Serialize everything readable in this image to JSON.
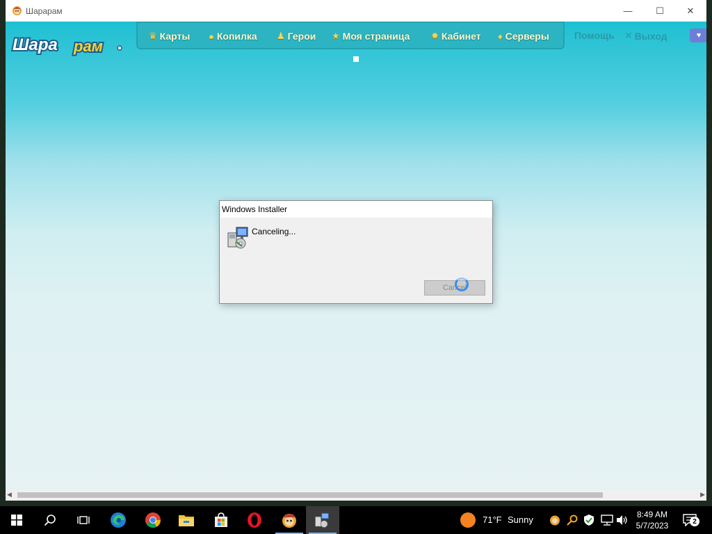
{
  "window": {
    "title": "Шарарам",
    "minimize_glyph": "—",
    "maximize_glyph": "☐",
    "close_glyph": "✕"
  },
  "site": {
    "logo_text": "Шарарам",
    "nav": [
      {
        "label": "Карты",
        "icon": "crown-icon",
        "glyph": "♛"
      },
      {
        "label": "Копилка",
        "icon": "piggy-bank-icon",
        "glyph": "●"
      },
      {
        "label": "Герои",
        "icon": "hero-icon",
        "glyph": "♟"
      },
      {
        "label": "Моя страница",
        "icon": "star-icon",
        "glyph": "★"
      },
      {
        "label": "Кабинет",
        "icon": "gear-icon",
        "glyph": "✹"
      },
      {
        "label": "Серверы",
        "icon": "map-pin-icon",
        "glyph": "♦"
      }
    ],
    "help_label": "Помощь",
    "exit_label": "Выход",
    "exit_glyph": "✕",
    "heart_glyph": "♥"
  },
  "dialog": {
    "title": "Windows Installer",
    "message": "Canceling...",
    "button_label": "Cancel"
  },
  "taskbar": {
    "weather_temp": "71°F",
    "weather_text": "Sunny",
    "time": "8:49 AM",
    "date": "5/7/2023",
    "notification_count": "2"
  },
  "colors": {
    "accent": "#1ec0d2",
    "nav_text": "#fff6c8",
    "taskbar": "#000000"
  }
}
